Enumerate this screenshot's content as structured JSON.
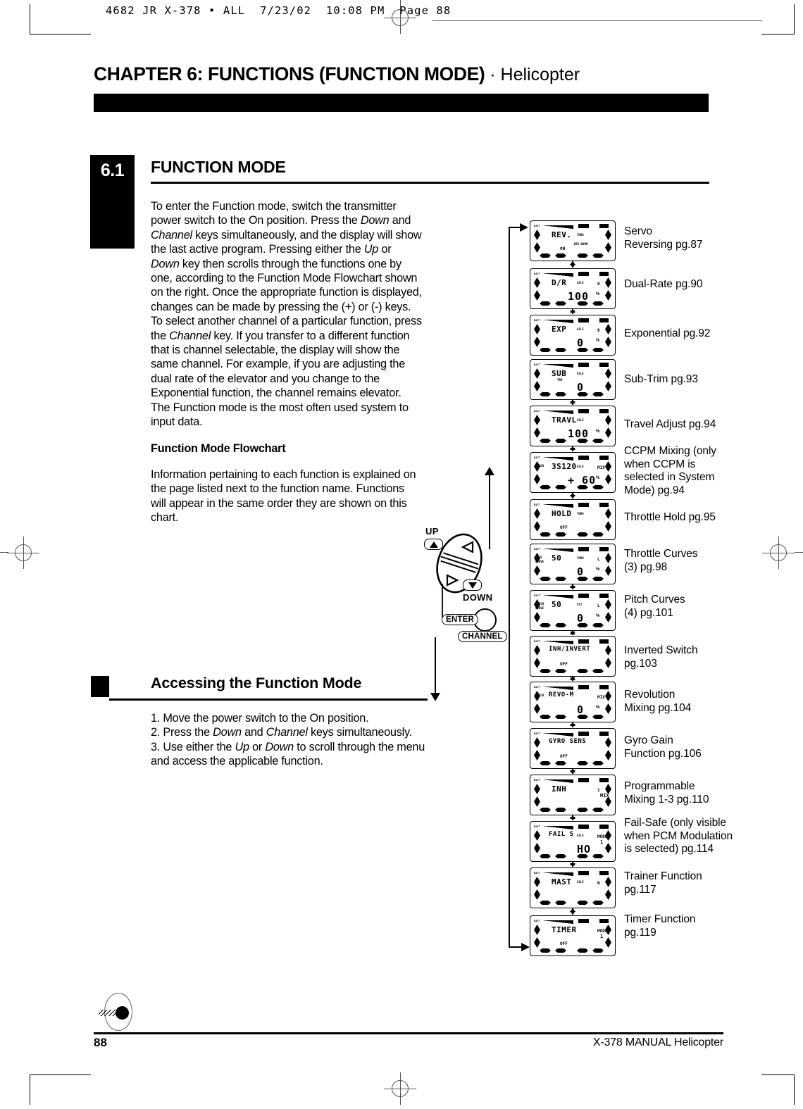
{
  "file_header": "4682 JR X-378 • ALL  7/23/02  10:08 PM  Page 88",
  "chapter": {
    "title_bold": "CHAPTER 6: FUNCTIONS (FUNCTION MODE)",
    "title_sep": " · ",
    "title_light": "Helicopter"
  },
  "section": {
    "number": "6.1",
    "heading": "FUNCTION MODE",
    "paragraph1_a": "To enter the Function mode, switch the transmitter power switch to the On position. Press the ",
    "paragraph1_i1": "Down",
    "paragraph1_b": " and ",
    "paragraph1_i2": "Channel",
    "paragraph1_c": " keys simultaneously, and the display will show the last active program. Pressing either the ",
    "paragraph1_i3": "Up",
    "paragraph1_d": " or ",
    "paragraph1_i4": "Down",
    "paragraph1_e": " key then scrolls through the functions one by one, according to the Function Mode Flowchart shown on the right. Once the appropriate function is displayed, changes can be made by pressing the (+) or (-) keys. To select another channel of a particular function, press the ",
    "paragraph1_i5": "Channel",
    "paragraph1_f": " key. If you transfer to a different function that is channel selectable, the display will show the same channel. For example, if you are adjusting the dual rate of the elevator and you change to the Exponential function, the channel remains elevator. The Function mode is the most often used system to input data.",
    "flowchart_heading": "Function Mode Flowchart",
    "flowchart_text": "Information pertaining to each function is explained on the page listed next to the function name. Functions will appear in the same order they are shown on this chart."
  },
  "accessing": {
    "heading": "Accessing the Function Mode",
    "step1": "1. Move the power switch to the On position.",
    "step2_a": "2. Press the ",
    "step2_i1": "Down",
    "step2_b": " and ",
    "step2_i2": "Channel",
    "step2_c": " keys simultaneously.",
    "step3_a": "3. Use either the ",
    "step3_i1": "Up",
    "step3_b": " or ",
    "step3_i2": "Down",
    "step3_c": " to scroll through the menu and access the applicable function."
  },
  "controls": {
    "up_label": "UP",
    "down_label": "DOWN",
    "enter_label": "ENTER",
    "channel_label": "CHANNEL"
  },
  "chart_data": {
    "type": "diagram-flowchart",
    "title": "Function Mode Flowchart",
    "note": "Vertical loop of LCD screens; each screen scrolls to the next via Up/Down keys",
    "screens": [
      {
        "fn": "REV.",
        "sub": "THRO",
        "mid": "REV-NORM",
        "mid2": "ON",
        "label": "Servo\nReversing pg.87",
        "label_lines": [
          "Servo",
          "Reversing pg.87"
        ]
      },
      {
        "fn": "D/R",
        "sub": "AILE",
        "corner": "0",
        "big": "100",
        "unit": "%",
        "label_lines": [
          "Dual-Rate pg.90"
        ]
      },
      {
        "fn": "EXP",
        "sub": "AILE",
        "corner": "0",
        "big": "0",
        "unit": "%",
        "label_lines": [
          "Exponential pg.92"
        ]
      },
      {
        "fn": "SUB",
        "fn2": "TRM",
        "sub": "AILE",
        "big": "0",
        "label_lines": [
          "Sub-Trim pg.93"
        ]
      },
      {
        "fn": "TRAVL",
        "sub": "AILE",
        "big": "100",
        "unit": "%",
        "label_lines": [
          "Travel Adjust pg.94"
        ]
      },
      {
        "fn": "3S120",
        "sub": "AILE",
        "left": "SWASH",
        "big": "+ 60",
        "unit": "%",
        "corner": "MIX",
        "label_lines": [
          "CCPM Mixing (only",
          "when CCPM is",
          "selected in System",
          "Mode) pg.94"
        ]
      },
      {
        "fn": "HOLD",
        "sub": "THRO",
        "mid2": "OFF",
        "label_lines": [
          "Throttle Hold pg.95"
        ]
      },
      {
        "fn": "50",
        "left": "HOLD",
        "left2": "CURVE",
        "sub": "THRO",
        "corner": "L",
        "big": "0",
        "unit": "%",
        "label_lines": [
          "Throttle Curves",
          "(3) pg.98"
        ]
      },
      {
        "fn": "50",
        "left": "PITCH",
        "left2": "CURVE",
        "sub": "PIT.",
        "corner": "L",
        "big": "0",
        "unit": "%",
        "label_lines": [
          "Pitch Curves",
          "(4) pg.101"
        ]
      },
      {
        "fn": "INH/INVERT",
        "mid2": "OFF",
        "label_lines": [
          "Inverted Switch",
          "pg.103"
        ]
      },
      {
        "fn": "REVO-M",
        "left": "PITCH",
        "big": "0",
        "unit": "%",
        "corner": "MIX",
        "label_lines": [
          "Revolution",
          "Mixing pg.104"
        ]
      },
      {
        "fn": "GYRO SENS",
        "mid2": "OFF",
        "label_lines": [
          "Gyro Gain",
          "Function pg.106"
        ]
      },
      {
        "fn": "INH",
        "corner": "1",
        "corner2": "MIX",
        "label_lines": [
          "Programmable",
          "Mixing 1-3 pg.110"
        ]
      },
      {
        "fn": "FAIL S",
        "sub": "AILE",
        "corner": "MODEL",
        "corner2": "1",
        "big": "HO",
        "label_lines": [
          "Fail-Safe (only visible",
          "when PCM Modulation",
          "is selected) pg.114"
        ]
      },
      {
        "fn": "MAST",
        "sub": "AILE",
        "corner": "N",
        "label_lines": [
          "Trainer Function",
          "pg.117"
        ]
      },
      {
        "fn": "TIMER",
        "corner": "MODEL",
        "corner2": "1",
        "mid2": "OFF",
        "label_lines": [
          "Timer Function",
          "pg.119"
        ]
      }
    ]
  },
  "footer": {
    "page_number": "88",
    "manual_text": "X-378 MANUAL  Helicopter"
  }
}
